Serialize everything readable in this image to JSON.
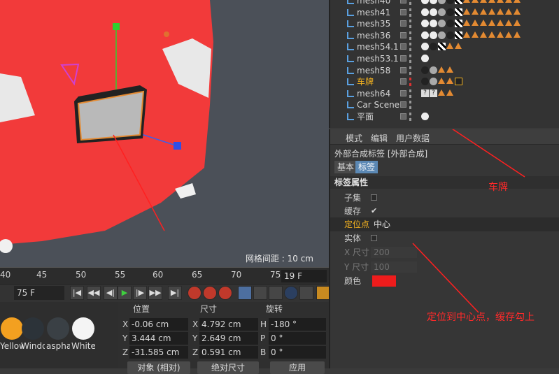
{
  "viewport": {
    "grid_readout": "网格间距 : 10 cm",
    "colors": {
      "background": "#4b5058",
      "car_body": "#f23a3a",
      "plate": "#b9b9b9",
      "plate_border": "#e38a32"
    }
  },
  "timeline": {
    "ruler_ticks": [
      "40",
      "45",
      "50",
      "55",
      "60",
      "65",
      "70",
      "75"
    ],
    "current_frame": "19 F",
    "end_frame": "75 F",
    "buttons": [
      "|◀",
      "◀◀",
      "◀|",
      "▶",
      "|▶",
      "▶▶",
      "▶|"
    ]
  },
  "materials": [
    {
      "label": "Yellow",
      "color": "#f3a020"
    },
    {
      "label": "Window",
      "color": "#2c3339"
    },
    {
      "label": "asphalt",
      "color": "#3a4045"
    },
    {
      "label": "White",
      "color": "#f4f4f4"
    }
  ],
  "coordinates": {
    "headers": {
      "position": "位置",
      "size": "尺寸",
      "rotation": "旋转"
    },
    "rows": [
      {
        "axis": "X",
        "position": "-0.06 cm",
        "size_axis": "X",
        "size": "4.792 cm",
        "rot_axis": "H",
        "rotation": "-180 °"
      },
      {
        "axis": "Y",
        "position": "3.444 cm",
        "size_axis": "Y",
        "size": "2.649 cm",
        "rot_axis": "P",
        "rotation": "0 °"
      },
      {
        "axis": "Z",
        "position": "-31.585 cm",
        "size_axis": "Z",
        "size": "0.591 cm",
        "rot_axis": "B",
        "rotation": "0 °"
      }
    ],
    "mode_dropdown": "对象 (相对)",
    "size_dropdown": "绝对尺寸",
    "apply_button": "应用"
  },
  "objects": [
    {
      "name": "mesh40",
      "tags": "full"
    },
    {
      "name": "mesh41",
      "tags": "full"
    },
    {
      "name": "mesh35",
      "tags": "full"
    },
    {
      "name": "mesh36",
      "tags": "full"
    },
    {
      "name": "mesh54.1",
      "tags": "mid"
    },
    {
      "name": "mesh53.1",
      "tags": "short"
    },
    {
      "name": "mesh58",
      "tags": "small"
    },
    {
      "name": "车牌",
      "tags": "plate",
      "highlight": true
    },
    {
      "name": "mesh64",
      "tags": "q"
    },
    {
      "name": "Car Scene",
      "tags": "none"
    },
    {
      "name": "平面",
      "tags": "plane"
    }
  ],
  "attributes": {
    "menu": [
      "模式",
      "编辑",
      "用户数据"
    ],
    "title": "外部合成标签 [外部合成]",
    "tabs": [
      "基本",
      "标签"
    ],
    "section": "标签属性",
    "props": [
      {
        "label": "子集",
        "type": "checkbox",
        "checked": false
      },
      {
        "label": "缓存",
        "type": "checkbox",
        "checked": true
      },
      {
        "label": "定位点",
        "type": "dropdown",
        "value": "中心",
        "highlight": true
      },
      {
        "label": "实体",
        "type": "checkbox",
        "checked": false
      },
      {
        "label": "X 尺寸",
        "type": "number",
        "value": "200",
        "disabled": true
      },
      {
        "label": "Y 尺寸",
        "type": "number",
        "value": "100",
        "disabled": true
      },
      {
        "label": "颜色",
        "type": "color",
        "value": "#ee1c1c"
      }
    ]
  },
  "annotations": {
    "plate_note": "车牌",
    "anchor_note": "定位到中心点，缓存勾上"
  }
}
